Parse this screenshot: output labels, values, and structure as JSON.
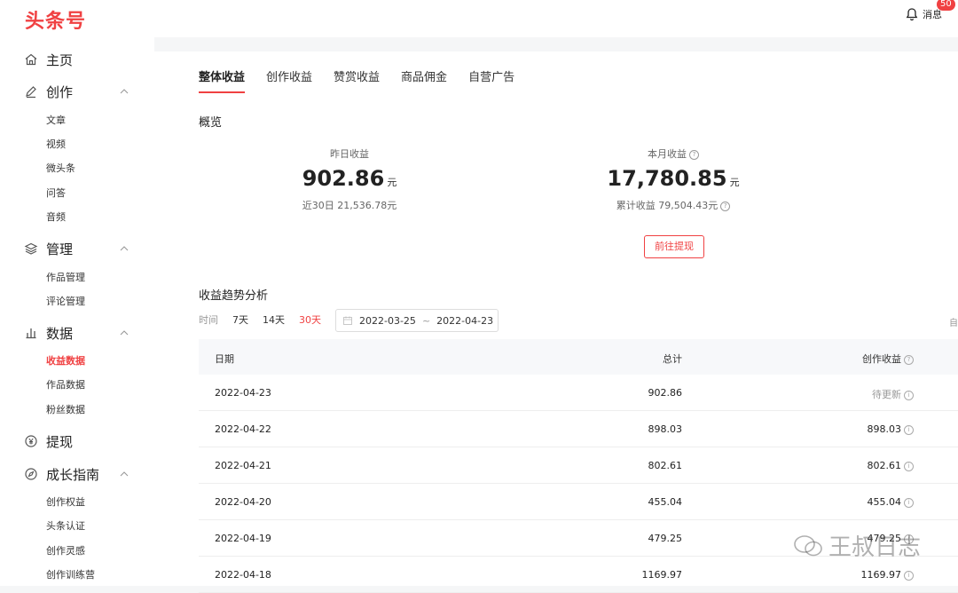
{
  "header": {
    "logo": "头条号",
    "message_label": "消息",
    "message_badge": "50"
  },
  "sidebar": {
    "groups": [
      {
        "label": "主页"
      },
      {
        "label": "创作",
        "items": [
          "文章",
          "视频",
          "微头条",
          "问答",
          "音频"
        ]
      },
      {
        "label": "管理",
        "items": [
          "作品管理",
          "评论管理"
        ]
      },
      {
        "label": "数据",
        "items": [
          "收益数据",
          "作品数据",
          "粉丝数据"
        ]
      },
      {
        "label": "提现"
      },
      {
        "label": "成长指南",
        "items": [
          "创作权益",
          "头条认证",
          "创作灵感",
          "创作训练营"
        ]
      }
    ],
    "active_item": "收益数据"
  },
  "tabs": [
    "整体收益",
    "创作收益",
    "赞赏收益",
    "商品佣金",
    "自营广告"
  ],
  "overview": {
    "title": "概览",
    "yesterday": {
      "label": "昨日收益",
      "value": "902.86",
      "unit": "元",
      "sub": "近30日 21,536.78元"
    },
    "month": {
      "label": "本月收益",
      "value": "17,780.85",
      "unit": "元",
      "sub": "累计收益 79,504.43元"
    },
    "withdraw_button": "前往提现"
  },
  "trend": {
    "title": "收益趋势分析",
    "range_label": "时间",
    "ranges": [
      "7天",
      "14天",
      "30天"
    ],
    "active_range": "30天",
    "date_start": "2022-03-25",
    "date_sep": "~",
    "date_end": "2022-04-23",
    "edge_text": "自"
  },
  "table": {
    "headers": [
      "日期",
      "总计",
      "创作收益"
    ],
    "rows": [
      [
        "2022-04-23",
        "902.86",
        "待更新"
      ],
      [
        "2022-04-22",
        "898.03",
        "898.03"
      ],
      [
        "2022-04-21",
        "802.61",
        "802.61"
      ],
      [
        "2022-04-20",
        "455.04",
        "455.04"
      ],
      [
        "2022-04-19",
        "479.25",
        "479.25"
      ],
      [
        "2022-04-18",
        "1169.97",
        "1169.97"
      ]
    ]
  },
  "watermark": "王叔日志",
  "colors": {
    "accent": "#f04142",
    "sidebar_bg": "#ffffff",
    "page_bg": "#f5f6f7"
  }
}
